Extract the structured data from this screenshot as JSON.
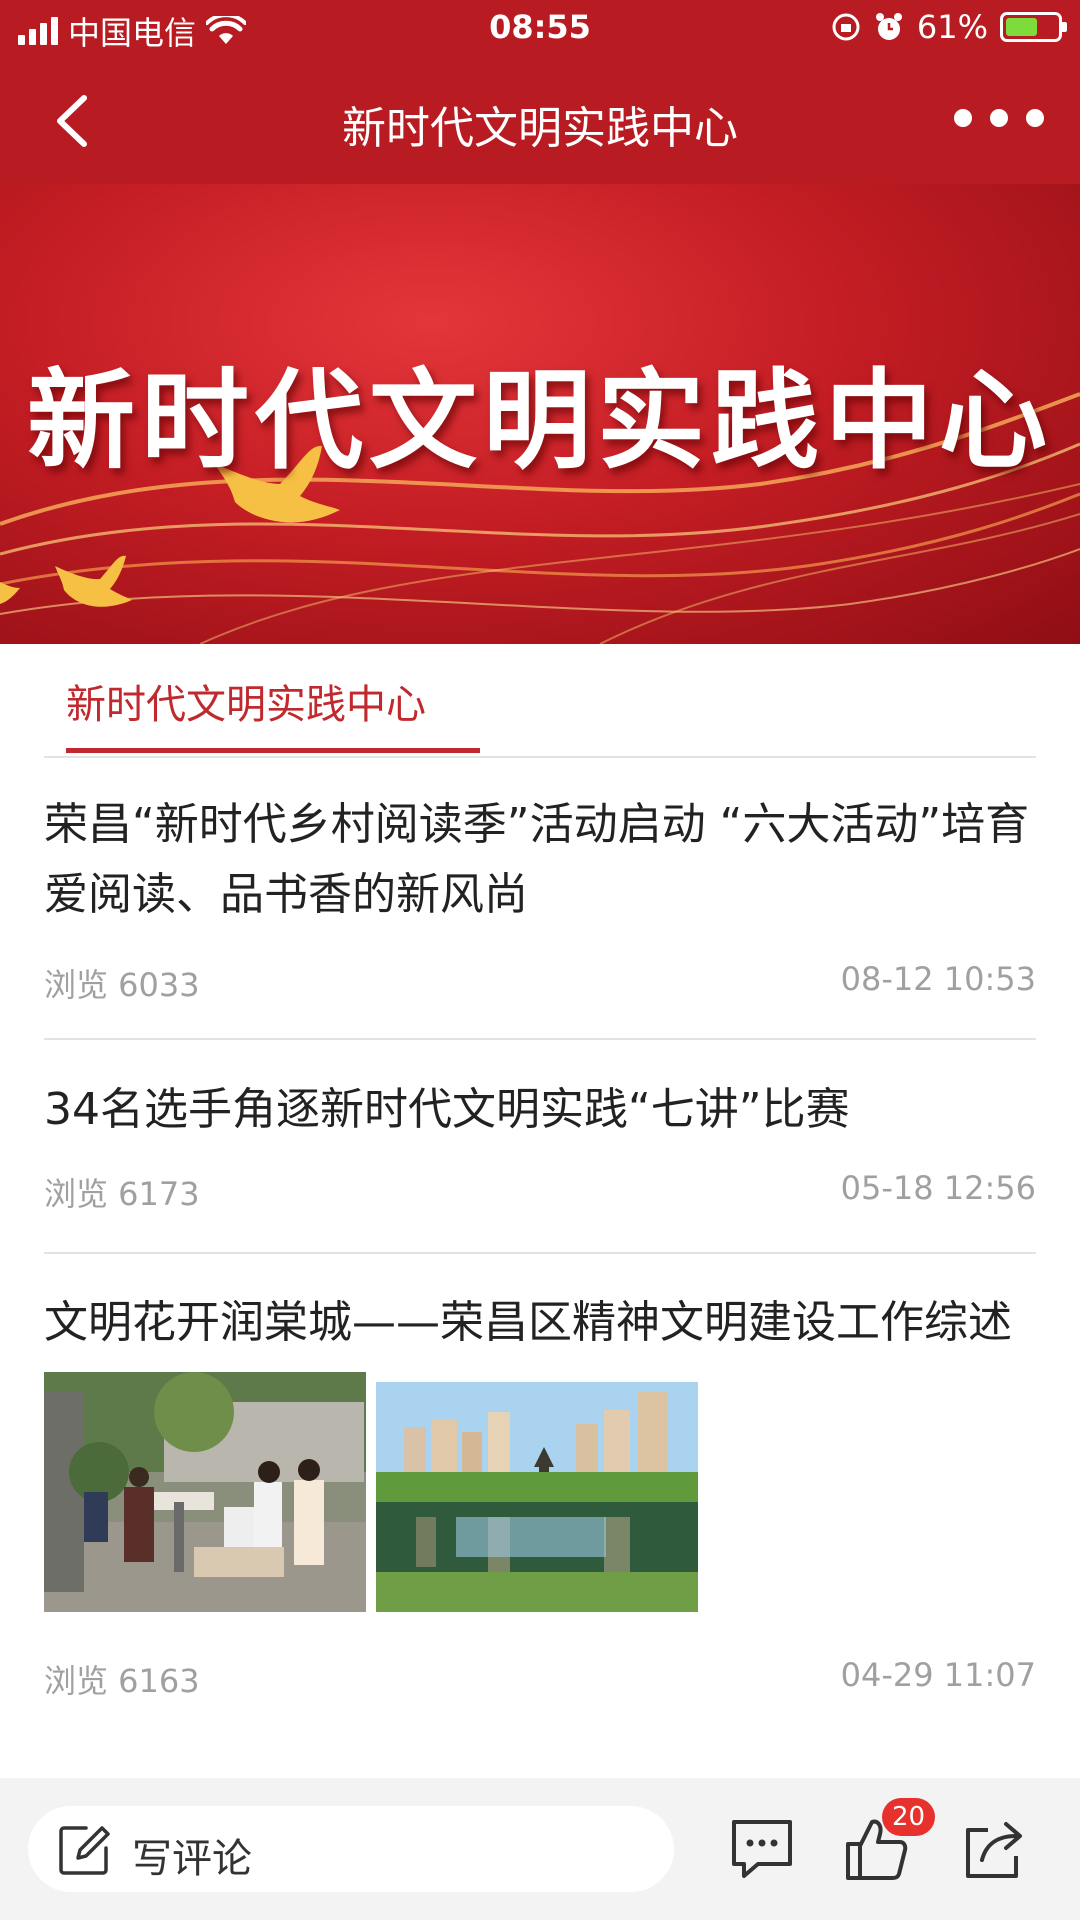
{
  "status_bar": {
    "carrier": "中国电信",
    "time": "08:55",
    "battery": "61%",
    "battery_level": 0.61
  },
  "nav": {
    "title": "新时代文明实践中心"
  },
  "banner": {
    "title": "新时代文明实践中心"
  },
  "tabs": [
    {
      "label": "新时代文明实践中心",
      "active": true
    }
  ],
  "articles": [
    {
      "title": "荣昌“新时代乡村阅读季”活动启动 “六大活动”培育爱阅读、品书香的新风尚",
      "views": "浏览 6033",
      "date": "08-12 10:53"
    },
    {
      "title": "34名选手角逐新时代文明实践“七讲”比赛",
      "views": "浏览 6173",
      "date": "05-18 12:56"
    },
    {
      "title": "文明花开润棠城——荣昌区精神文明建设工作综述",
      "views": "浏览 6163",
      "date": "04-29 11:07"
    }
  ],
  "bottom_bar": {
    "comment_label": "写评论",
    "like_count": "20"
  },
  "colors": {
    "brand_red": "#b81c22",
    "accent_red": "#c0292e",
    "meta_gray": "#a0a0a0",
    "badge_red": "#e7312d"
  },
  "icons": [
    "wifi-icon",
    "alarm-icon",
    "battery-icon",
    "back-arrow-icon",
    "more-icon",
    "edit-icon",
    "comment-icon",
    "like-icon",
    "share-icon"
  ]
}
